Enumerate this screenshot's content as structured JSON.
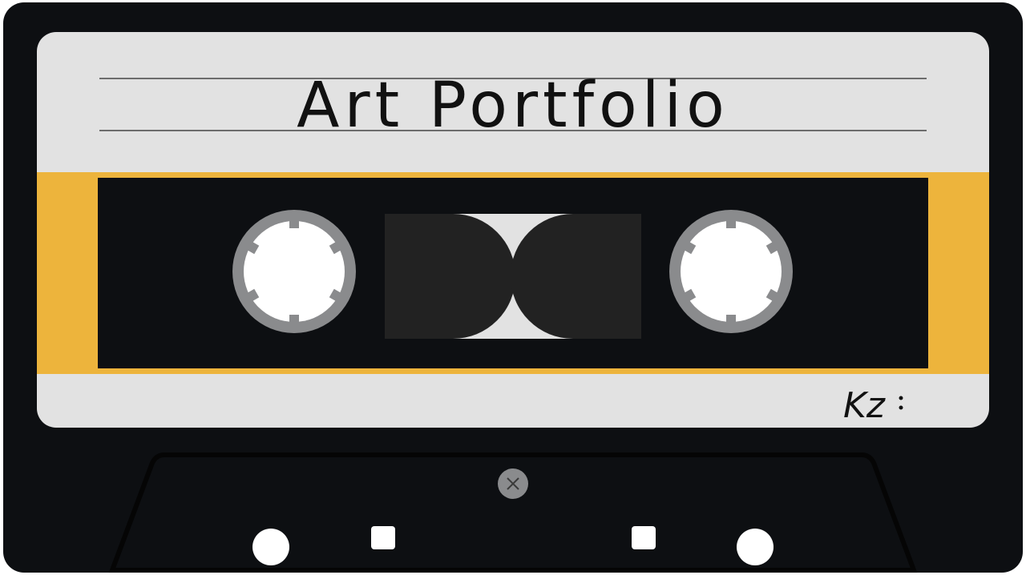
{
  "cassette": {
    "label_title": "Art  Portfolio",
    "signature": "Kz"
  },
  "colors": {
    "shell": "#0d0f12",
    "label_paper": "#e2e2e2",
    "stripe": "#edb43c",
    "window": "#0d0f12",
    "tape": "#222222",
    "reel_ring": "#8a8b8d",
    "reel_hub": "#ffffff",
    "screw": "#8a8b8d"
  }
}
